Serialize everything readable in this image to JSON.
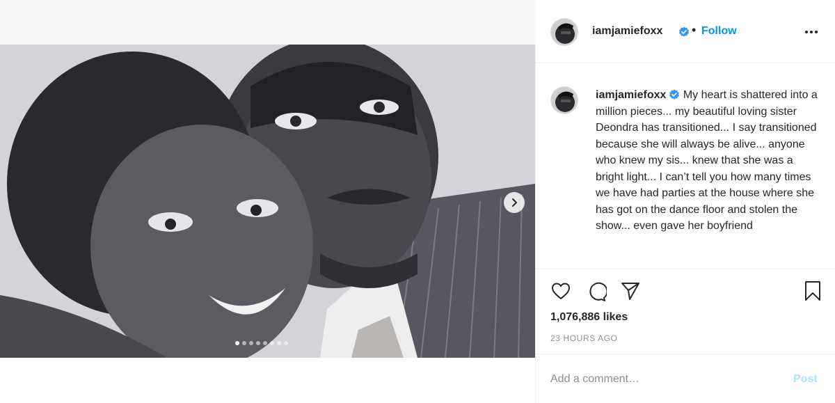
{
  "post": {
    "username": "iamjamiefoxx",
    "follow_label": "Follow",
    "separator": "•",
    "caption": "My heart is shattered into a million pieces... my beautiful loving sister Deondra has transitioned... I say transitioned because she will always be alive... anyone who knew my sis... knew that she was a bright light... I can’t tell you how many times we have had parties at the house where she has got on the dance floor and stolen the show... even gave her boyfriend",
    "likes": "1,076,886 likes",
    "timestamp": "23 HOURS AGO",
    "carousel": {
      "total": 8,
      "active": 1
    }
  },
  "comment": {
    "placeholder": "Add a comment…",
    "post_label": "Post"
  },
  "icons": {
    "verified": "verified-badge-icon",
    "more": "more-options-icon",
    "like": "heart-icon",
    "comment": "comment-bubble-icon",
    "share": "paper-plane-icon",
    "save": "bookmark-icon",
    "next": "chevron-right-icon"
  },
  "colors": {
    "accent": "#0095f6",
    "post_disabled": "#b2dffc",
    "secondary_text": "#8e8e8e",
    "divider": "#efefef"
  }
}
